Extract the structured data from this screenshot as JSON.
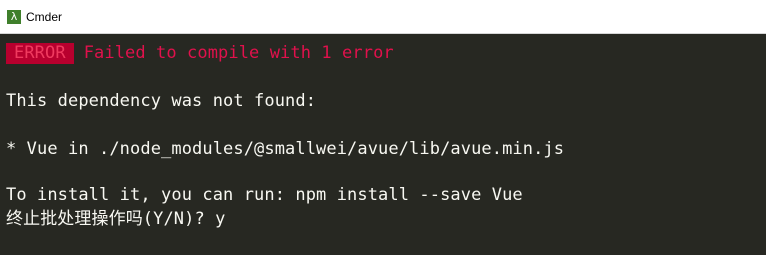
{
  "window": {
    "title": "Cmder",
    "icon": "lambda-icon",
    "icon_glyph": "λ"
  },
  "colors": {
    "background": "#272822",
    "text": "#f8f8f2",
    "error_badge_bg": "#b8002e",
    "error_text": "#e0114c"
  },
  "terminal": {
    "error_badge": "ERROR",
    "error_message": "Failed to compile with 1 error",
    "line_dependency": "This dependency was not found:",
    "line_module": "* Vue in ./node_modules/@smallwei/avue/lib/avue.min.js",
    "line_install": "To install it, you can run: npm install --save Vue",
    "line_prompt": "终止批处理操作吗(Y/N)? y"
  }
}
